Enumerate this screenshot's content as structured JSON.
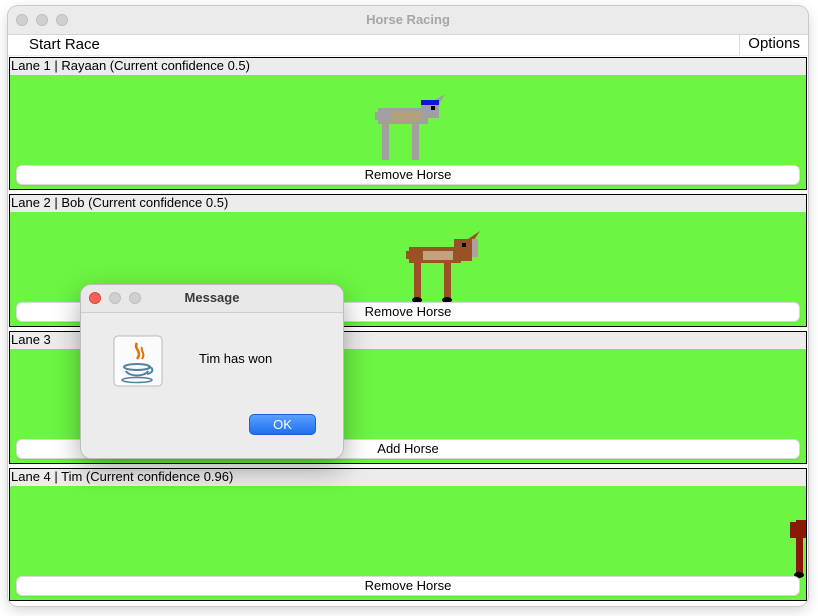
{
  "window": {
    "title": "Horse Racing"
  },
  "menu": {
    "start_race": "Start Race",
    "options": "Options"
  },
  "lanes": [
    {
      "label": "Lane 1 | Rayaan (Current confidence 0.5)",
      "button": "Remove Horse",
      "horse": "grey"
    },
    {
      "label": "Lane 2 | Bob (Current confidence 0.5)",
      "button": "Remove Horse",
      "horse": "brown"
    },
    {
      "label": "Lane 3",
      "button": "Add Horse",
      "horse": "none"
    },
    {
      "label": "Lane 4 | Tim (Current confidence 0.96)",
      "button": "Remove Horse",
      "horse": "darkred"
    }
  ],
  "dialog": {
    "title": "Message",
    "message": "Tim has won",
    "ok": "OK",
    "icon": "java-icon"
  },
  "colors": {
    "track": "#6cf542",
    "accent": "#1f6ff0",
    "horse_grey": "#a0a0a0",
    "horse_brown": "#9a5126",
    "horse_darkred": "#8a1a06"
  }
}
